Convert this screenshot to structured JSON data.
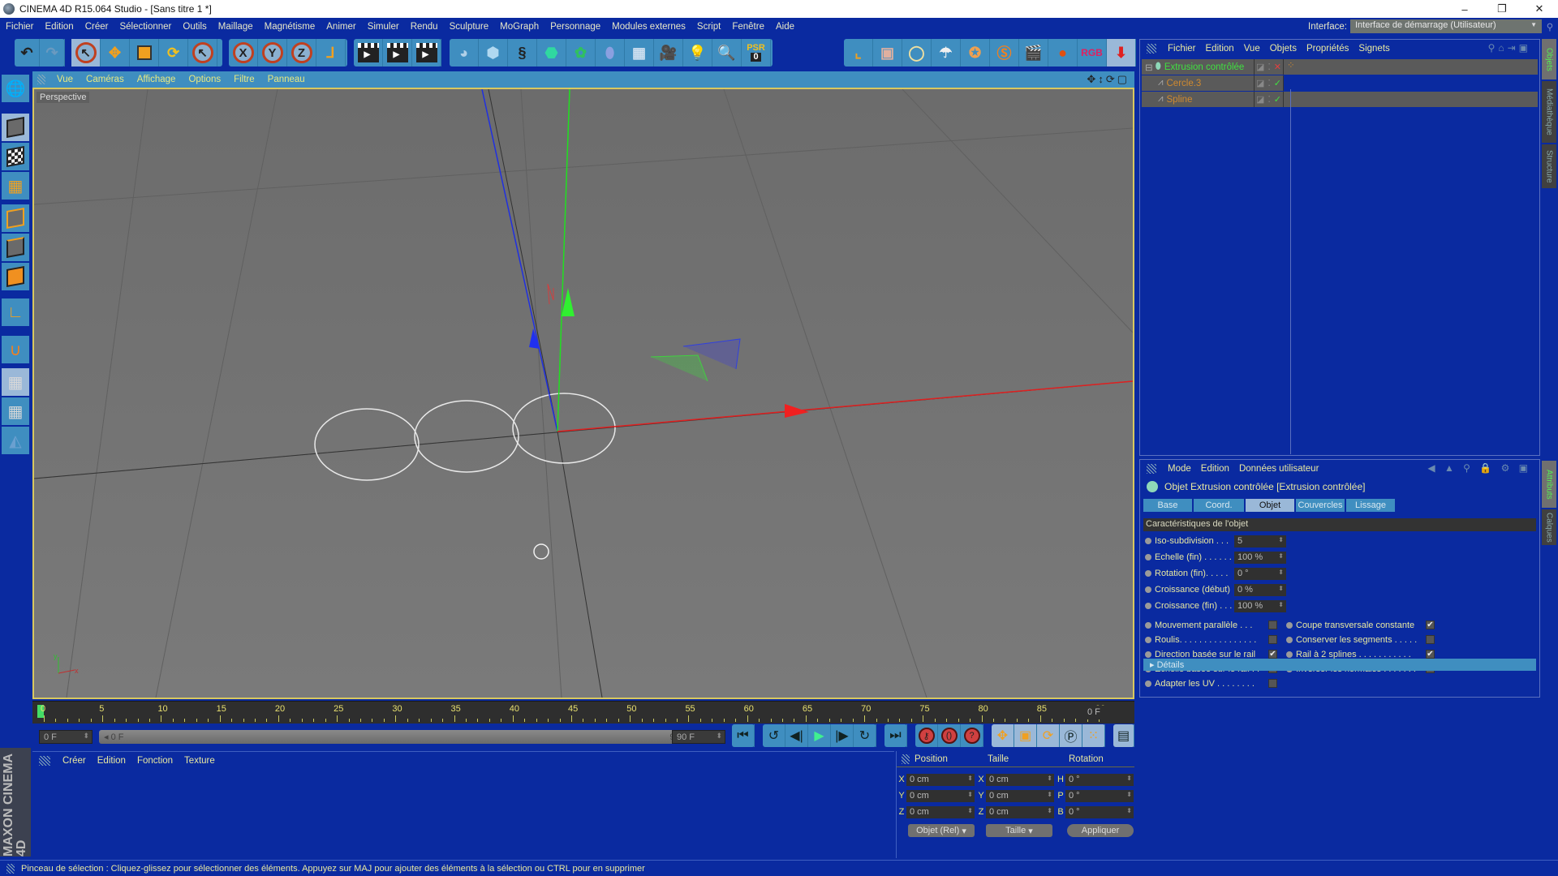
{
  "window": {
    "title": "CINEMA 4D R15.064 Studio - [Sans titre 1 *]",
    "controls": [
      "–",
      "❐",
      "✕"
    ]
  },
  "menubar": {
    "items": [
      "Fichier",
      "Edition",
      "Créer",
      "Sélectionner",
      "Outils",
      "Maillage",
      "Magnétisme",
      "Animer",
      "Simuler",
      "Rendu",
      "Sculpture",
      "MoGraph",
      "Personnage",
      "Modules externes",
      "Script",
      "Fenêtre",
      "Aide"
    ],
    "interface_label": "Interface:",
    "interface_value": "Interface de démarrage (Utilisateur)"
  },
  "toolbar": {
    "undo": "↶",
    "redo": "↷",
    "axis_x": "X",
    "axis_y": "Y",
    "axis_z": "Z",
    "psr_label": "PSR",
    "psr_value": "0"
  },
  "viewport": {
    "menu": [
      "Vue",
      "Caméras",
      "Affichage",
      "Options",
      "Filtre",
      "Panneau"
    ],
    "camera_label": "Perspective",
    "nav_icons": "✥↕⟳▢"
  },
  "timeline": {
    "ticks": [
      "0",
      "5",
      "10",
      "15",
      "20",
      "25",
      "30",
      "35",
      "40",
      "45",
      "50",
      "55",
      "60",
      "65",
      "70",
      "75",
      "80",
      "85",
      "90"
    ],
    "current_frame": "0 F",
    "start_field": "0 F",
    "range_start": "◂ 0 F",
    "range_end": "90 F ▸",
    "end_field": "90 F"
  },
  "playback": {
    "buttons": [
      "⏮",
      "↺",
      "◀|",
      "▶",
      "|▶",
      "↻",
      "⏭"
    ]
  },
  "material_manager": {
    "menu": [
      "Créer",
      "Edition",
      "Fonction",
      "Texture"
    ]
  },
  "branding": {
    "text": "MAXON CINEMA 4D"
  },
  "coordinates": {
    "headers": [
      "Position",
      "Taille",
      "Rotation"
    ],
    "rows": [
      {
        "axis": "X",
        "pos": "0 cm",
        "size_axis": "X",
        "size": "0 cm",
        "rot_axis": "H",
        "rot": "0 °"
      },
      {
        "axis": "Y",
        "pos": "0 cm",
        "size_axis": "Y",
        "size": "0 cm",
        "rot_axis": "P",
        "rot": "0 °"
      },
      {
        "axis": "Z",
        "pos": "0 cm",
        "size_axis": "Z",
        "size": "0 cm",
        "rot_axis": "B",
        "rot": "0 °"
      }
    ],
    "mode_select": "Objet (Rel)",
    "size_select": "Taille",
    "apply_button": "Appliquer"
  },
  "status": {
    "text": "Pinceau de sélection : Cliquez-glissez pour sélectionner des éléments. Appuyez sur MAJ pour ajouter des éléments à la sélection ou CTRL pour en supprimer"
  },
  "object_manager": {
    "menu": [
      "Fichier",
      "Edition",
      "Vue",
      "Objets",
      "Propriétés",
      "Signets"
    ],
    "objects": [
      {
        "name": "Extrusion contrôlée",
        "color": "#40e040",
        "level": 0,
        "flag": "✕",
        "flag_color": "#e04040"
      },
      {
        "name": "Cercle.3",
        "color": "#d08a30",
        "level": 1,
        "flag": "✓",
        "flag_color": "#40e040"
      },
      {
        "name": "Spline",
        "color": "#d08a30",
        "level": 1,
        "flag": "✓",
        "flag_color": "#40e040"
      }
    ]
  },
  "attributes": {
    "menu": [
      "Mode",
      "Edition",
      "Données utilisateur"
    ],
    "title": "Objet Extrusion contrôlée [Extrusion contrôlée]",
    "tabs": [
      "Base",
      "Coord.",
      "Objet",
      "Couvercles",
      "Lissage"
    ],
    "active_tab": "Objet",
    "section": "Caractéristiques de l'objet",
    "fields": [
      {
        "label": "Iso-subdivision . . .",
        "value": "5"
      },
      {
        "label": "Echelle (fin) . . . . . .",
        "value": "100 %"
      },
      {
        "label": "Rotation (fin). . . . .",
        "value": "0 °"
      },
      {
        "label": "Croissance (début)",
        "value": "0 %"
      },
      {
        "label": "Croissance (fin) . . .",
        "value": "100 %"
      }
    ],
    "checks_left": [
      {
        "label": "Mouvement parallèle . . .",
        "checked": false
      },
      {
        "label": "Roulis. . . . . . . . . . . . . . . .",
        "checked": false
      },
      {
        "label": "Direction basée sur le rail",
        "checked": true
      },
      {
        "label": "Echelle basée sur le rail . .",
        "checked": true
      },
      {
        "label": "Adapter les UV . . . . . . . .",
        "checked": false
      }
    ],
    "checks_right": [
      {
        "label": "Coupe transversale constante",
        "checked": true
      },
      {
        "label": "Conserver les segments . . . . .",
        "checked": false
      },
      {
        "label": "Rail à 2 splines . . . . . . . . . . .",
        "checked": true
      },
      {
        "label": "Inverser les normales . . . . . . .",
        "checked": false
      }
    ],
    "details": "▸ Détails"
  },
  "side_tabs": {
    "top": [
      "Objets",
      "Médiathèque",
      "Structure"
    ],
    "bottom": [
      "Attributs",
      "Calques"
    ]
  },
  "colors": {
    "accent_blue": "#0a2aa0",
    "panel_blue": "#3f8ec0",
    "axis_x": "#e02020",
    "axis_y": "#20d020",
    "axis_z": "#2020e0",
    "text_yellow": "#e8e8a0"
  }
}
